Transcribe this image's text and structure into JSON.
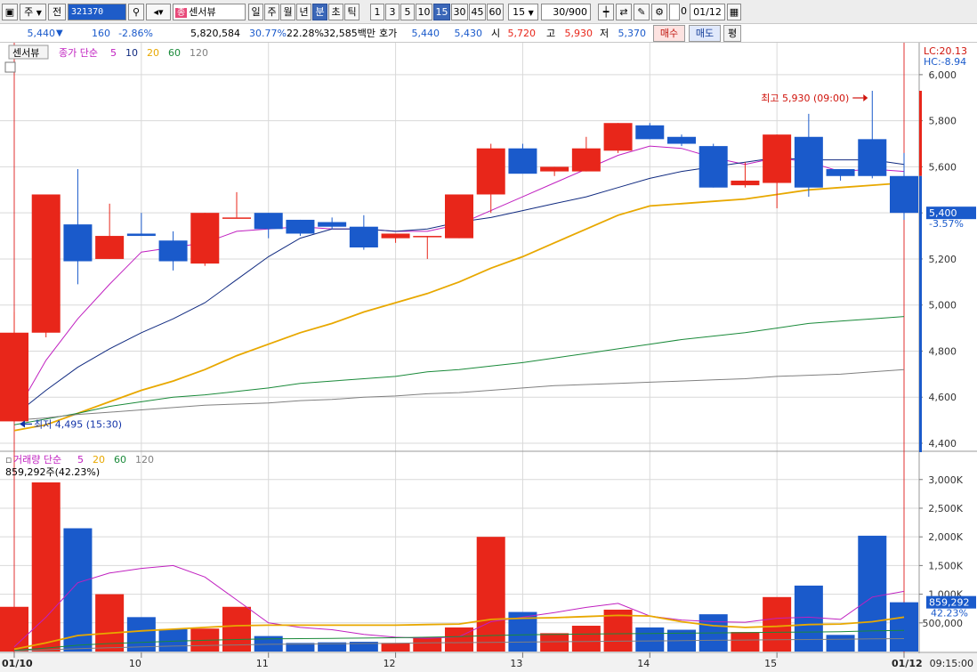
{
  "toolbar": {
    "mode_label": "주",
    "prev_label": "전",
    "stock_code": "321370",
    "stock_badge": "종",
    "stock_name": "센서뷰",
    "period_tabs": [
      "일",
      "주",
      "월",
      "년",
      "분",
      "초",
      "틱"
    ],
    "selected_period": "분",
    "interval_tabs": [
      "1",
      "3",
      "5",
      "10",
      "15",
      "30",
      "45",
      "60"
    ],
    "selected_interval": "15",
    "interval_value": "15",
    "count_value": "30/900",
    "date_value": "01/12",
    "date_checkbox_label": "0"
  },
  "quote": {
    "price": "5,440",
    "change": "160",
    "change_pct": "-2.86%",
    "volume": "5,820,584",
    "vol_ratio": "30.77%",
    "turnover": "22.28%",
    "amount": "32,585백만",
    "ask_label": "호가",
    "ask1": "5,440",
    "bid1": "5,430",
    "open_label": "시",
    "open": "5,720",
    "high_label": "고",
    "high": "5,930",
    "low_label": "저",
    "low": "5,370",
    "buy_label": "매수",
    "sell_label": "매도",
    "avg_label": "평"
  },
  "legend": {
    "stock_tag": "센서뷰",
    "price_legend_prefix": "종가 단순",
    "ma_periods": [
      "5",
      "10",
      "20",
      "60",
      "120"
    ],
    "volume_legend_prefix": "거래량 단순",
    "volume_info": "859,292주(42.23%)"
  },
  "chart_data": {
    "type": "candlestick",
    "interval": "15 minute",
    "price_axis": {
      "range": [
        4400,
        6100
      ],
      "ticks": [
        "4,400",
        "4,600",
        "4,800",
        "5,000",
        "5,200",
        "5,400",
        "5,600",
        "5,800",
        "6,000"
      ],
      "tick_values": [
        4400,
        4600,
        4800,
        5000,
        5200,
        5400,
        5600,
        5800,
        6000
      ],
      "current_price_label": "5,400",
      "current_change_label": "-3.57%",
      "lc_label": "LC:20.13",
      "hc_label": "HC:-8.94"
    },
    "volume_axis": {
      "range": [
        0,
        3400000
      ],
      "ticks": [
        "500,000",
        "1,000K",
        "1,500K",
        "2,000K",
        "2,500K",
        "3,000K"
      ],
      "tick_values": [
        500000,
        1000000,
        1500000,
        2000000,
        2500000,
        3000000
      ],
      "current_volume_label": "859,292",
      "current_volume_pct_label": "42.23%"
    },
    "x_axis": {
      "labels": [
        {
          "index": 0,
          "text": "01/10"
        },
        {
          "index": 4,
          "text": "10"
        },
        {
          "index": 8,
          "text": "11"
        },
        {
          "index": 12,
          "text": "12"
        },
        {
          "index": 16,
          "text": "13"
        },
        {
          "index": 20,
          "text": "14"
        },
        {
          "index": 24,
          "text": "15"
        },
        {
          "index": 28,
          "text": "01/12"
        }
      ],
      "right_label": "09:15:00"
    },
    "vertical_markers": [
      0,
      28
    ],
    "candles": [
      {
        "o": 4495,
        "h": 4970,
        "l": 4495,
        "c": 4880,
        "v": 780000
      },
      {
        "o": 4880,
        "h": 5480,
        "l": 4860,
        "c": 5480,
        "v": 2950000
      },
      {
        "o": 5350,
        "h": 5590,
        "l": 5090,
        "c": 5190,
        "v": 2150000
      },
      {
        "o": 5200,
        "h": 5440,
        "l": 5200,
        "c": 5300,
        "v": 1000000
      },
      {
        "o": 5310,
        "h": 5400,
        "l": 5300,
        "c": 5300,
        "v": 600000
      },
      {
        "o": 5280,
        "h": 5320,
        "l": 5150,
        "c": 5190,
        "v": 390000
      },
      {
        "o": 5180,
        "h": 5400,
        "l": 5170,
        "c": 5400,
        "v": 400000
      },
      {
        "o": 5380,
        "h": 5490,
        "l": 5380,
        "c": 5380,
        "v": 780000
      },
      {
        "o": 5400,
        "h": 5400,
        "l": 5290,
        "c": 5330,
        "v": 270000
      },
      {
        "o": 5370,
        "h": 5370,
        "l": 5300,
        "c": 5310,
        "v": 150000
      },
      {
        "o": 5360,
        "h": 5380,
        "l": 5330,
        "c": 5340,
        "v": 160000
      },
      {
        "o": 5340,
        "h": 5390,
        "l": 5240,
        "c": 5250,
        "v": 170000
      },
      {
        "o": 5290,
        "h": 5310,
        "l": 5270,
        "c": 5310,
        "v": 150000
      },
      {
        "o": 5300,
        "h": 5300,
        "l": 5200,
        "c": 5300,
        "v": 250000
      },
      {
        "o": 5290,
        "h": 5480,
        "l": 5290,
        "c": 5480,
        "v": 420000
      },
      {
        "o": 5480,
        "h": 5700,
        "l": 5400,
        "c": 5680,
        "v": 2000000
      },
      {
        "o": 5680,
        "h": 5700,
        "l": 5580,
        "c": 5570,
        "v": 690000
      },
      {
        "o": 5580,
        "h": 5600,
        "l": 5560,
        "c": 5600,
        "v": 320000
      },
      {
        "o": 5580,
        "h": 5730,
        "l": 5580,
        "c": 5680,
        "v": 450000
      },
      {
        "o": 5670,
        "h": 5790,
        "l": 5660,
        "c": 5790,
        "v": 730000
      },
      {
        "o": 5780,
        "h": 5790,
        "l": 5720,
        "c": 5720,
        "v": 420000
      },
      {
        "o": 5730,
        "h": 5740,
        "l": 5690,
        "c": 5700,
        "v": 380000
      },
      {
        "o": 5690,
        "h": 5700,
        "l": 5510,
        "c": 5510,
        "v": 650000
      },
      {
        "o": 5520,
        "h": 5620,
        "l": 5510,
        "c": 5540,
        "v": 340000
      },
      {
        "o": 5530,
        "h": 5740,
        "l": 5420,
        "c": 5740,
        "v": 950000
      },
      {
        "o": 5730,
        "h": 5830,
        "l": 5470,
        "c": 5510,
        "v": 1150000
      },
      {
        "o": 5590,
        "h": 5590,
        "l": 5540,
        "c": 5560,
        "v": 290000
      },
      {
        "o": 5720,
        "h": 5930,
        "l": 5550,
        "c": 5560,
        "v": 2020000
      },
      {
        "o": 5560,
        "h": 5660,
        "l": 5370,
        "c": 5400,
        "v": 859292
      }
    ],
    "ma_lines": [
      {
        "period": "5",
        "color": "#c020c0",
        "values": [
          4520,
          4760,
          4940,
          5090,
          5230,
          5250,
          5270,
          5320,
          5330,
          5340,
          5330,
          5330,
          5320,
          5320,
          5350,
          5410,
          5470,
          5530,
          5590,
          5650,
          5690,
          5680,
          5640,
          5610,
          5640,
          5620,
          5580,
          5590,
          5580
        ]
      },
      {
        "period": "10",
        "color": "#102a80",
        "values": [
          4520,
          4630,
          4730,
          4810,
          4880,
          4940,
          5010,
          5110,
          5210,
          5290,
          5330,
          5330,
          5320,
          5330,
          5360,
          5380,
          5410,
          5440,
          5470,
          5510,
          5550,
          5580,
          5600,
          5620,
          5640,
          5630,
          5630,
          5630,
          5610
        ]
      },
      {
        "period": "20",
        "color": "#e8a800",
        "values": [
          4455,
          4480,
          4530,
          4580,
          4630,
          4670,
          4720,
          4780,
          4830,
          4880,
          4920,
          4970,
          5010,
          5050,
          5100,
          5160,
          5210,
          5270,
          5330,
          5390,
          5430,
          5440,
          5450,
          5460,
          5480,
          5500,
          5510,
          5520,
          5530
        ]
      },
      {
        "period": "60",
        "color": "#1a8a3a",
        "values": [
          4480,
          4505,
          4530,
          4560,
          4580,
          4600,
          4610,
          4625,
          4640,
          4660,
          4670,
          4680,
          4690,
          4710,
          4720,
          4735,
          4750,
          4770,
          4790,
          4810,
          4830,
          4850,
          4865,
          4880,
          4900,
          4920,
          4930,
          4940,
          4950
        ]
      },
      {
        "period": "120",
        "color": "#808080",
        "values": [
          4500,
          4510,
          4525,
          4535,
          4545,
          4555,
          4565,
          4570,
          4575,
          4585,
          4590,
          4600,
          4605,
          4615,
          4620,
          4630,
          4640,
          4650,
          4655,
          4660,
          4665,
          4670,
          4675,
          4680,
          4690,
          4695,
          4700,
          4710,
          4720
        ]
      }
    ],
    "volume_ma_lines": [
      {
        "period": "5",
        "color": "#c020c0",
        "values": [
          80000,
          600000,
          1200000,
          1370000,
          1450000,
          1500000,
          1300000,
          900000,
          500000,
          420000,
          380000,
          300000,
          250000,
          230000,
          260000,
          520000,
          600000,
          680000,
          770000,
          840000,
          620000,
          550000,
          520000,
          510000,
          580000,
          600000,
          560000,
          950000,
          1050000
        ]
      },
      {
        "period": "20",
        "color": "#e8a800",
        "values": [
          40000,
          150000,
          280000,
          320000,
          360000,
          390000,
          420000,
          450000,
          460000,
          460000,
          460000,
          460000,
          460000,
          470000,
          480000,
          560000,
          580000,
          590000,
          610000,
          630000,
          620000,
          520000,
          450000,
          420000,
          440000,
          470000,
          480000,
          520000,
          600000
        ]
      },
      {
        "period": "60",
        "color": "#1a8a3a",
        "values": [
          20000,
          60000,
          110000,
          140000,
          160000,
          180000,
          195000,
          210000,
          220000,
          225000,
          230000,
          235000,
          240000,
          250000,
          260000,
          280000,
          290000,
          300000,
          305000,
          310000,
          315000,
          320000,
          325000,
          330000,
          335000,
          340000,
          345000,
          360000,
          370000
        ]
      },
      {
        "period": "120",
        "color": "#808080",
        "values": [
          10000,
          30000,
          50000,
          65000,
          80000,
          95000,
          105000,
          115000,
          125000,
          130000,
          135000,
          140000,
          145000,
          150000,
          155000,
          160000,
          165000,
          170000,
          175000,
          180000,
          185000,
          190000,
          195000,
          200000,
          205000,
          210000,
          215000,
          220000,
          225000
        ]
      }
    ],
    "annotations": {
      "high": {
        "index": 27,
        "value": 5930,
        "text": "최고 5,930 (09:00)"
      },
      "low": {
        "index": 0,
        "value": 4495,
        "text": "최저 4,495 (15:30)"
      }
    },
    "colors": {
      "up": "#e8261a",
      "down": "#1a5acb",
      "grid": "#d9d9d9",
      "marker": "#e03030"
    },
    "grid": true
  }
}
